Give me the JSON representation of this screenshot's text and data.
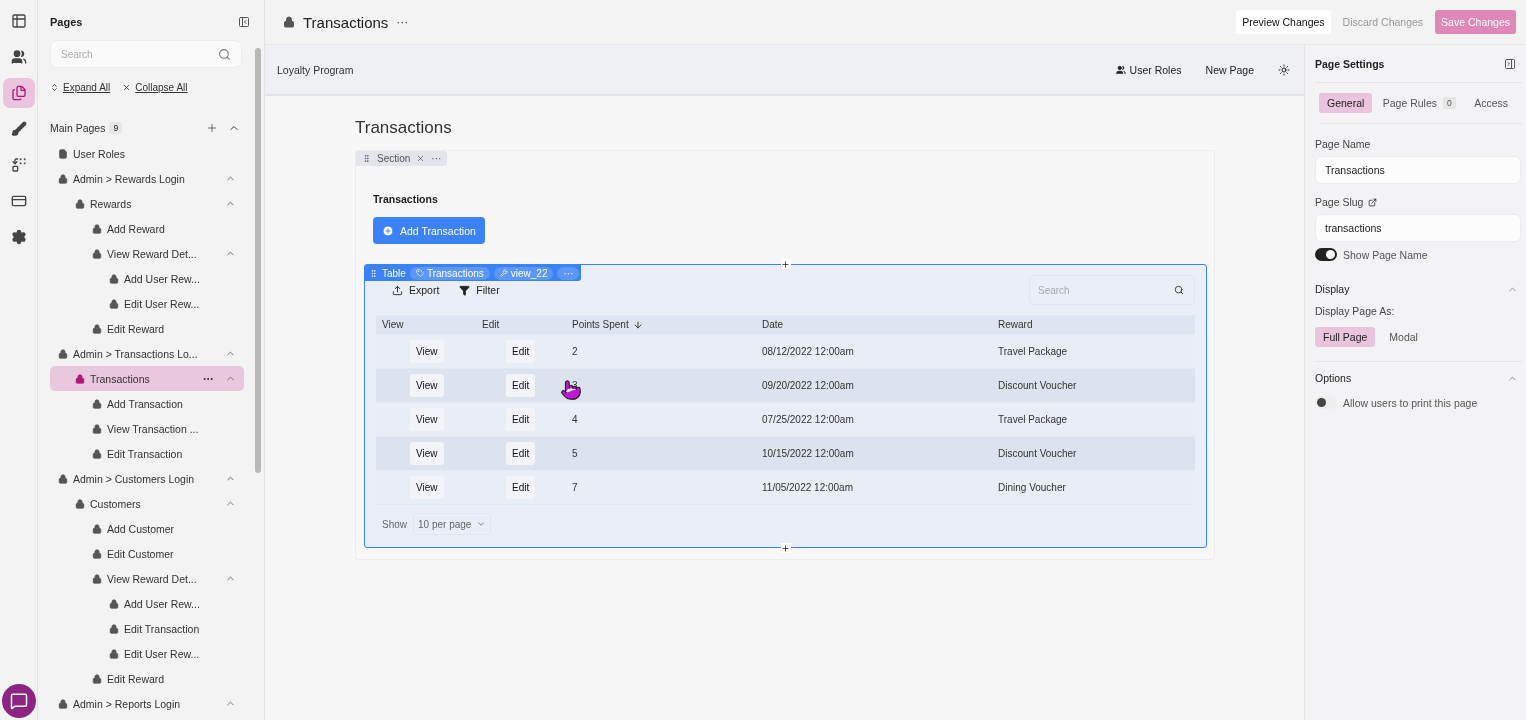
{
  "rail": [
    {
      "selected": false
    },
    {
      "selected": false
    },
    {
      "selected": true
    },
    {
      "selected": false
    },
    {
      "selected": false
    },
    {
      "selected": false
    },
    {
      "selected": false
    }
  ],
  "pages_panel": {
    "title": "Pages",
    "search": {
      "placeholder": "Search"
    },
    "expand_all": "Expand All",
    "collapse_all": "Collapse All",
    "group": {
      "label": "Main Pages",
      "count": "9",
      "expanded": true
    },
    "tree": [
      {
        "label": "User Roles",
        "locked": false,
        "selected": false
      },
      {
        "label": "Admin > Rewards Login",
        "locked": true,
        "selected": false,
        "expanded": true,
        "children": [
          {
            "label": "Rewards",
            "locked": true,
            "selected": false,
            "expanded": true,
            "children": [
              {
                "label": "Add Reward",
                "locked": true,
                "selected": false
              },
              {
                "label": "View Reward Det...",
                "locked": true,
                "selected": false,
                "expanded": true,
                "children": [
                  {
                    "label": "Add User Rew...",
                    "locked": true,
                    "selected": false
                  },
                  {
                    "label": "Edit User Rew...",
                    "locked": true,
                    "selected": false
                  }
                ]
              },
              {
                "label": "Edit Reward",
                "locked": true,
                "selected": false
              }
            ]
          }
        ]
      },
      {
        "label": "Admin > Transactions Lo...",
        "locked": true,
        "selected": false,
        "expanded": true,
        "children": [
          {
            "label": "Transactions",
            "locked": true,
            "selected": true,
            "expanded": true,
            "children": [
              {
                "label": "Add Transaction",
                "locked": true,
                "selected": false
              },
              {
                "label": "View Transaction ...",
                "locked": true,
                "selected": false
              },
              {
                "label": "Edit Transaction",
                "locked": true,
                "selected": false
              }
            ]
          }
        ]
      },
      {
        "label": "Admin > Customers Login",
        "locked": true,
        "selected": false,
        "expanded": true,
        "children": [
          {
            "label": "Customers",
            "locked": true,
            "selected": false,
            "expanded": true,
            "children": [
              {
                "label": "Add Customer",
                "locked": true,
                "selected": false
              },
              {
                "label": "Edit Customer",
                "locked": true,
                "selected": false
              },
              {
                "label": "View Reward Det...",
                "locked": true,
                "selected": false,
                "expanded": true,
                "children": [
                  {
                    "label": "Add User Rew...",
                    "locked": true,
                    "selected": false
                  },
                  {
                    "label": "Edit Transaction",
                    "locked": true,
                    "selected": false
                  },
                  {
                    "label": "Edit User Rew...",
                    "locked": true,
                    "selected": false
                  }
                ]
              },
              {
                "label": "Edit Reward",
                "locked": true,
                "selected": false
              }
            ]
          }
        ]
      },
      {
        "label": "Admin > Reports Login",
        "locked": true,
        "selected": false,
        "expanded": true
      }
    ]
  },
  "topbar": {
    "title": "Transactions",
    "more": "···",
    "preview": "Preview Changes",
    "discard": "Discard Changes",
    "save": "Save Changes"
  },
  "app_header": {
    "brand": "Loyalty Program",
    "user_roles": "User Roles",
    "new_page": "New Page"
  },
  "canvas": {
    "heading": "Transactions",
    "section_tag": "Section",
    "section_more": "···",
    "block_title": "Transactions",
    "add_button": "Add Transaction",
    "table_tag": {
      "kind": "Table",
      "source": "Transactions",
      "view": "view_22",
      "more": "···"
    },
    "export": "Export",
    "filter": "Filter",
    "search": {
      "placeholder": "Search"
    },
    "columns": [
      {
        "label": "View",
        "sorted": false
      },
      {
        "label": "Edit",
        "sorted": false
      },
      {
        "label": "Points Spent",
        "sorted": true
      },
      {
        "label": "Date",
        "sorted": false
      },
      {
        "label": "Reward",
        "sorted": false
      }
    ],
    "rows": [
      {
        "view": "View",
        "edit": "Edit",
        "points": "2",
        "date": "08/12/2022 12:00am",
        "reward": "Travel Package"
      },
      {
        "view": "View",
        "edit": "Edit",
        "points": "3",
        "date": "09/20/2022 12:00am",
        "reward": "Discount Voucher"
      },
      {
        "view": "View",
        "edit": "Edit",
        "points": "4",
        "date": "07/25/2022 12:00am",
        "reward": "Travel Package"
      },
      {
        "view": "View",
        "edit": "Edit",
        "points": "5",
        "date": "10/15/2022 12:00am",
        "reward": "Discount Voucher"
      },
      {
        "view": "View",
        "edit": "Edit",
        "points": "7",
        "date": "11/05/2022 12:00am",
        "reward": "Dining Voucher"
      }
    ],
    "show_label": "Show",
    "per_page": "10 per page"
  },
  "settings": {
    "title": "Page Settings",
    "tabs": [
      {
        "label": "General",
        "selected": true
      },
      {
        "label": "Page Rules",
        "badge": "0",
        "selected": false
      },
      {
        "label": "Access",
        "selected": false
      }
    ],
    "page_name_label": "Page Name",
    "page_name": "Transactions",
    "slug_label": "Page Slug",
    "slug": "transactions",
    "show_name": {
      "label": "Show Page Name",
      "on": true
    },
    "display": {
      "title": "Display",
      "expanded": true,
      "label": "Display Page As:",
      "options": [
        {
          "label": "Full Page",
          "selected": true
        },
        {
          "label": "Modal",
          "selected": false
        }
      ]
    },
    "options": {
      "title": "Options",
      "expanded": true,
      "print": {
        "label": "Allow users to print this page",
        "on": false
      }
    }
  }
}
